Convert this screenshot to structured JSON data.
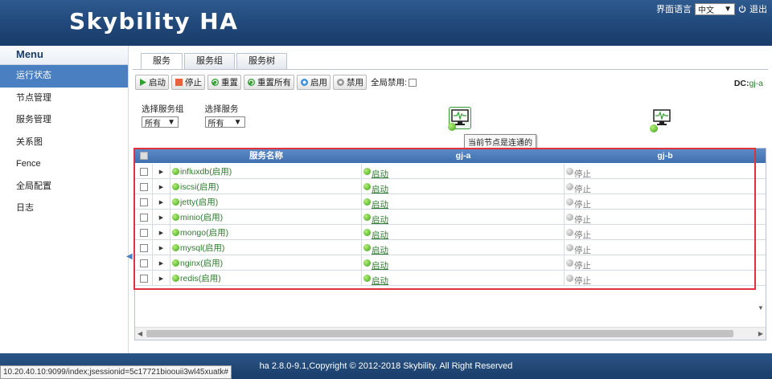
{
  "app": {
    "title": "Skybility HA",
    "lang_label": "界面语言",
    "lang_value": "中文",
    "logout_label": "退出"
  },
  "sidebar": {
    "title": "Menu",
    "items": [
      {
        "label": "运行状态",
        "active": true
      },
      {
        "label": "节点管理"
      },
      {
        "label": "服务管理"
      },
      {
        "label": "关系图"
      },
      {
        "label": "Fence"
      },
      {
        "label": "全局配置"
      },
      {
        "label": "日志"
      }
    ]
  },
  "tabs": [
    "服务",
    "服务组",
    "服务树"
  ],
  "toolbar": {
    "start": "启动",
    "stop": "停止",
    "reset": "重置",
    "reset_all": "重置所有",
    "enable": "启用",
    "disable": "禁用",
    "global_disable": "全局禁用:",
    "dc_label": "DC:",
    "dc_value": "gj-a"
  },
  "filters": {
    "group_label": "选择服务组",
    "group_value": "所有",
    "service_label": "选择服务",
    "service_value": "所有"
  },
  "tooltip": "当前节点是连通的",
  "grid": {
    "headers": [
      "服务名称",
      "gj-a",
      "gj-b"
    ],
    "rows": [
      {
        "name": "influxdb(启用)",
        "a": "启动",
        "b": "停止"
      },
      {
        "name": "iscsi(启用)",
        "a": "启动",
        "b": "停止"
      },
      {
        "name": "jetty(启用)",
        "a": "启动",
        "b": "停止"
      },
      {
        "name": "minio(启用)",
        "a": "启动",
        "b": "停止"
      },
      {
        "name": "mongo(启用)",
        "a": "启动",
        "b": "停止"
      },
      {
        "name": "mysql(启用)",
        "a": "启动",
        "b": "停止"
      },
      {
        "name": "nginx(启用)",
        "a": "启动",
        "b": "停止"
      },
      {
        "name": "redis(启用)",
        "a": "启动",
        "b": "停止"
      }
    ]
  },
  "footer": "ha 2.8.0-9.1,Copyright © 2012-2018 Skybility. All Right Reserved",
  "statusbar": "10.20.40.10:9099/index;jsessionid=5c17721bioouii3wl45xuatk#"
}
